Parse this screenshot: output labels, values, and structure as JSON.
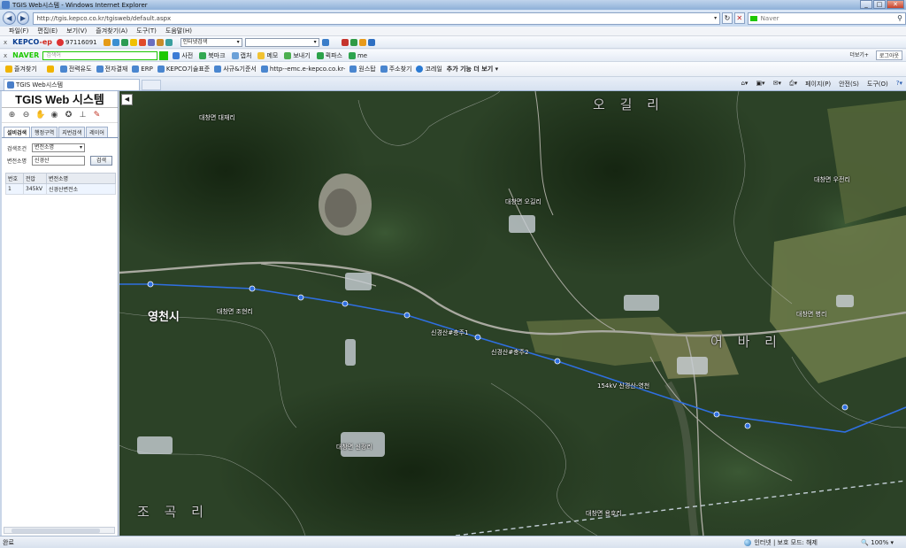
{
  "window": {
    "title": "TGIS Web시스템 - Windows Internet Explorer"
  },
  "address": {
    "url": "http://tgis.kepco.co.kr/tgisweb/default.aspx",
    "search_placeholder": "Naver"
  },
  "menu": [
    "파일(F)",
    "편집(E)",
    "보기(V)",
    "즐겨찾기(A)",
    "도구(T)",
    "도움말(H)"
  ],
  "kepco_bar": {
    "logo_main": "KEPCO",
    "logo_suffix": "-ep",
    "phone": "97116091",
    "items": [
      "인터넷검색"
    ]
  },
  "naver_bar": {
    "logo": "NAVER",
    "placeholder": "검색어",
    "items": [
      "사전",
      "북마크",
      "캡처",
      "메모",
      "보내기",
      "퀵파스",
      "me"
    ],
    "right": [
      "더보기+",
      "로그아웃"
    ]
  },
  "favorites": {
    "label": "즐겨찾기",
    "items": [
      "전력유도",
      "전자결재",
      "ERP",
      "KEPCO기술표준",
      "사규&기준서",
      "http--emc.e-kepco.co.kr-",
      "원스탑",
      "주소찾기",
      "코레일",
      "추가 기능 더 보기"
    ]
  },
  "tab": {
    "title": "TGIS Web시스템"
  },
  "commandbar": [
    "페이지(P)",
    "안전(S)",
    "도구(O)"
  ],
  "app": {
    "title": "TGIS Web 시스템",
    "tabs": [
      "설비검색",
      "행정구역",
      "지번검색",
      "레이어"
    ],
    "form": {
      "condition_label": "검색조건",
      "condition_value": "변전소명",
      "name_label": "변전소명",
      "name_value": "신경산",
      "search_button": "검색"
    },
    "results": {
      "headers": [
        "번호",
        "전압",
        "변전소명"
      ],
      "rows": [
        [
          "1",
          "345kV",
          "신경산변전소"
        ]
      ]
    }
  },
  "map": {
    "collapse_symbol": "◀",
    "labels": {
      "daechang_daejaeri": "대창면 대재리",
      "daechang_ogilri": "대창면 오길리",
      "daechang_ujeonri": "대창면 우전리",
      "yeongcheon": "영천시",
      "daechang_johyeonri": "대창면 조현리",
      "substation_line_1": "신경산#충주1",
      "substation_line_2": "신경산#충주2",
      "line_label_3": "154kV 신경산-영천",
      "daechang_sinjangri": "대창면 신장리",
      "daechang_byeongri": "대창면 병리",
      "daechang_yongri": "대창면 용호리",
      "ogilri_big": "오 길 리",
      "ebari_big": "어 바 리",
      "jogokri_big": "조 곡 리"
    },
    "route_color": "#2f6fe0",
    "road_color": "#a9a9a0",
    "terrain_color": "#2c4227"
  },
  "status": {
    "left": "완료",
    "zone": "인터넷 | 보호 모드: 해제",
    "zoom": "100%"
  }
}
